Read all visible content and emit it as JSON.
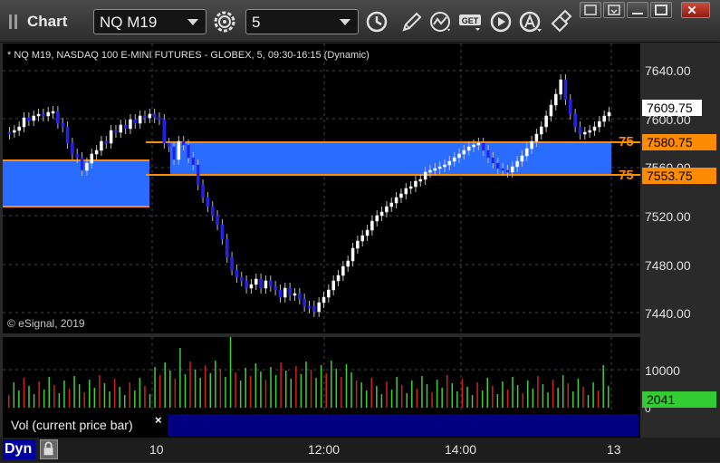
{
  "window": {
    "title": "Chart"
  },
  "toolbar": {
    "symbol": "NQ M19",
    "interval": "5"
  },
  "chart": {
    "info": "* NQ M19, NASDAQ 100 E-MINI FUTURES - GLOBEX, 5, 09:30-16:15 (Dynamic)",
    "watermark": "© eSignal, 2019",
    "price_axis": [
      "7640.00",
      "7600.00",
      "7560.00",
      "7520.00",
      "7480.00",
      "7440.00"
    ],
    "last_price": "7609.75",
    "level_upper": {
      "label": "75",
      "price": "7580.75",
      "color": "#ff8c00"
    },
    "level_lower": {
      "label": "75",
      "price": "7553.75",
      "color": "#ff8c00"
    },
    "zone_color": "#2a6cff",
    "up_color": "#ffffff",
    "down_color": "#2020e0"
  },
  "volume": {
    "axis": [
      "10000",
      "0"
    ],
    "last_volume": "2041",
    "label": "Vol (current price bar)",
    "up_color": "#3cd03c",
    "down_color": "#d02020"
  },
  "time_axis": [
    "10",
    "12:00",
    "14:00",
    "13"
  ],
  "status": {
    "mode": "Dyn"
  }
}
